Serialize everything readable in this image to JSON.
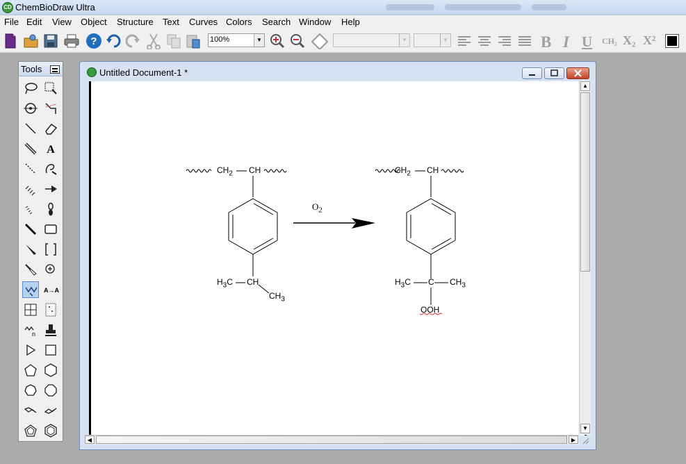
{
  "app": {
    "title": "ChemBioDraw Ultra"
  },
  "menu": [
    "File",
    "Edit",
    "View",
    "Object",
    "Structure",
    "Text",
    "Curves",
    "Colors",
    "Search",
    "Window",
    "Help"
  ],
  "toolbar": {
    "zoom_value": "100%",
    "icons": [
      "new-document-icon",
      "open-icon",
      "save-icon",
      "print-icon",
      "help-icon",
      "undo-icon",
      "redo-icon",
      "cut-icon",
      "copy-icon",
      "paste-icon",
      "zoom-in-icon",
      "zoom-out-icon",
      "show-crosshair-icon",
      "font-combo",
      "size-combo",
      "align-left-icon",
      "align-center-icon",
      "align-right-icon",
      "justify-icon",
      "bold",
      "italic",
      "underline",
      "formula",
      "subscript",
      "superscript",
      "color"
    ],
    "bold": "B",
    "italic": "I",
    "underline": "U",
    "formula": "CH₂",
    "subscript": "X₂",
    "superscript": "X²"
  },
  "tools_palette": {
    "title": "Tools",
    "tools": [
      "lasso",
      "marquee",
      "mass-fragmentation",
      "structure-perspective",
      "solid-bond",
      "eraser",
      "hashed-wedge",
      "text",
      "dashed-bond",
      "pen",
      "hashed-bond",
      "arrow",
      "wavy-bond",
      "orbital",
      "bold-bond",
      "drawing-elements",
      "wedge-bond",
      "brackets",
      "hollow-wedge",
      "chemical-symbols",
      "chain",
      "query",
      "table",
      "tlc-plate",
      "acyclic-chain",
      "templates",
      "play",
      "rectangle",
      "pentagon",
      "hexagon",
      "heptagon",
      "octagon",
      "cyclohexane-chair-1",
      "cyclohexane-chair-2",
      "cyclopentane",
      "benzene"
    ],
    "selected": "chain"
  },
  "document": {
    "title": "Untitled Document-1 *"
  },
  "reaction": {
    "reactant": {
      "chain_left": "CH",
      "chain_left_sub": "2",
      "chain_right": "CH",
      "isopropyl_left": "H",
      "isopropyl_left_sub": "3",
      "isopropyl_left_tail": "C",
      "isopropyl_center": "CH",
      "isopropyl_right": "CH",
      "isopropyl_right_sub": "3"
    },
    "reagent": {
      "text": "O",
      "sub": "2"
    },
    "product": {
      "chain_left": "CH",
      "chain_left_sub": "2",
      "chain_right": "CH",
      "left_group": "H",
      "left_group_sub": "3",
      "left_group_tail": "C",
      "center": "C",
      "right_group": "CH",
      "right_group_sub": "3",
      "hydroperoxy": "OOH"
    }
  }
}
